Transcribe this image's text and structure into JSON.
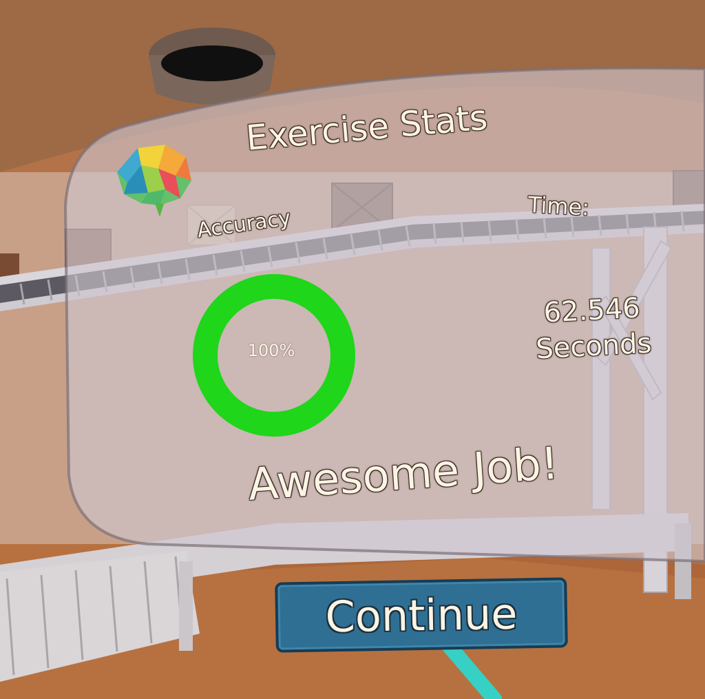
{
  "panel": {
    "title": "Exercise Stats",
    "logo_icon": "brain-icon"
  },
  "accuracy": {
    "label": "Accuracy",
    "value_text": "100%",
    "fraction": 1.0,
    "ring_color": "#1fd61a"
  },
  "time": {
    "label": "Time:",
    "value": "62.546",
    "unit": "Seconds"
  },
  "message": "Awesome Job!",
  "continue_button": {
    "label": "Continue",
    "color": "#2f6f93"
  },
  "pointer": {
    "color": "#36d1c4"
  }
}
